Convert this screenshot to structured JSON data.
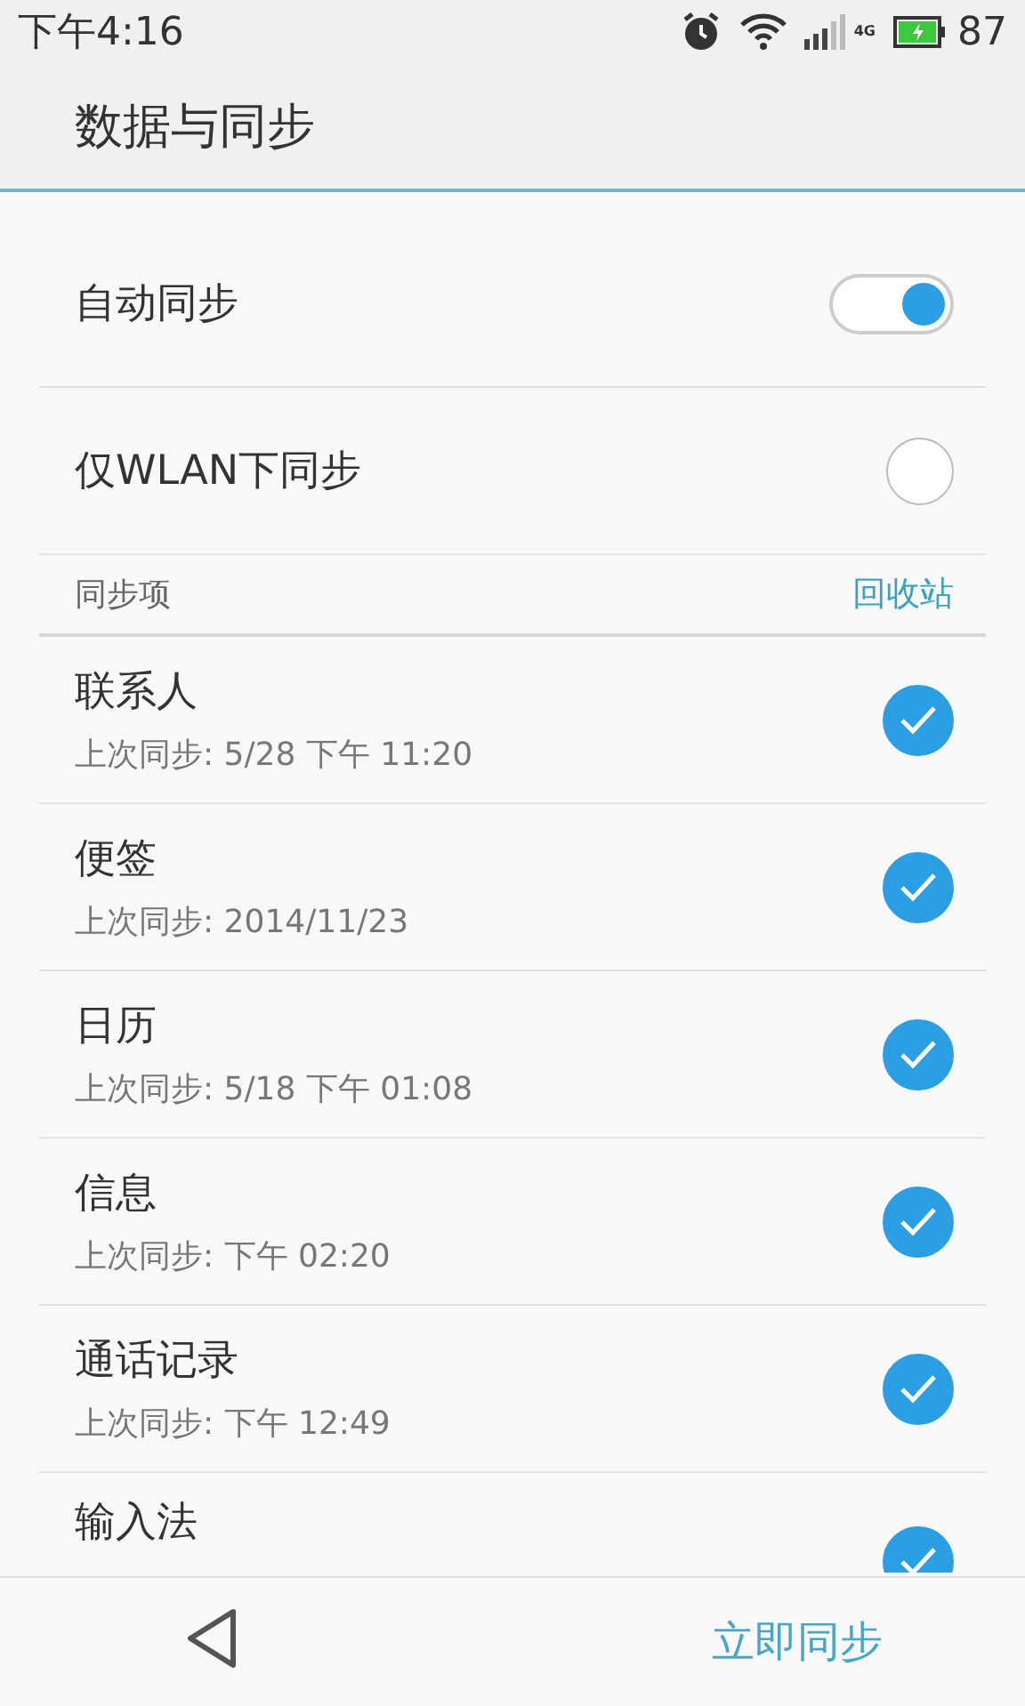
{
  "status_bar": {
    "time": "下午4:16",
    "network": "4G",
    "battery": "87"
  },
  "title": "数据与同步",
  "toggles": [
    {
      "kind": "switch",
      "label": "自动同步",
      "on": true
    },
    {
      "kind": "radio",
      "label": "仅WLAN下同步",
      "on": false
    }
  ],
  "section": {
    "title": "同步项",
    "action": "回收站"
  },
  "items": [
    {
      "name": "联系人",
      "last_sync": "上次同步: 5/28 下午 11:20",
      "checked": true
    },
    {
      "name": "便签",
      "last_sync": "上次同步: 2014/11/23",
      "checked": true
    },
    {
      "name": "日历",
      "last_sync": "上次同步: 5/18 下午 01:08",
      "checked": true
    },
    {
      "name": "信息",
      "last_sync": "上次同步: 下午 02:20",
      "checked": true
    },
    {
      "name": "通话记录",
      "last_sync": "上次同步: 下午 12:49",
      "checked": true
    },
    {
      "name": "输入法",
      "checked": true
    }
  ],
  "bottom_bar": {
    "action": "立即同步"
  }
}
